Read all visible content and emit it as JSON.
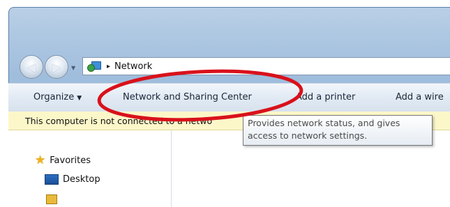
{
  "address": {
    "crumbs": [
      "Network"
    ],
    "separator": "▸"
  },
  "toolbar": {
    "organize": "Organize",
    "network_sharing": "Network and Sharing Center",
    "add_printer": "Add a printer",
    "add_wireless": "Add a wire"
  },
  "infobar": {
    "text": "This computer is not connected to a netwo"
  },
  "tooltip": {
    "line1": "Provides network status, and gives",
    "line2": "access to network settings."
  },
  "nav": {
    "favorites": "Favorites",
    "desktop": "Desktop"
  },
  "icons": {
    "back": "back-arrow-icon",
    "forward": "forward-arrow-icon",
    "network": "network-icon",
    "favorites": "star-icon",
    "desktop": "desktop-icon",
    "downloads": "folder-icon"
  },
  "colors": {
    "annotation": "#d9111b",
    "infobar_bg": "#fcf7c9",
    "tooltip_border": "#767676"
  }
}
